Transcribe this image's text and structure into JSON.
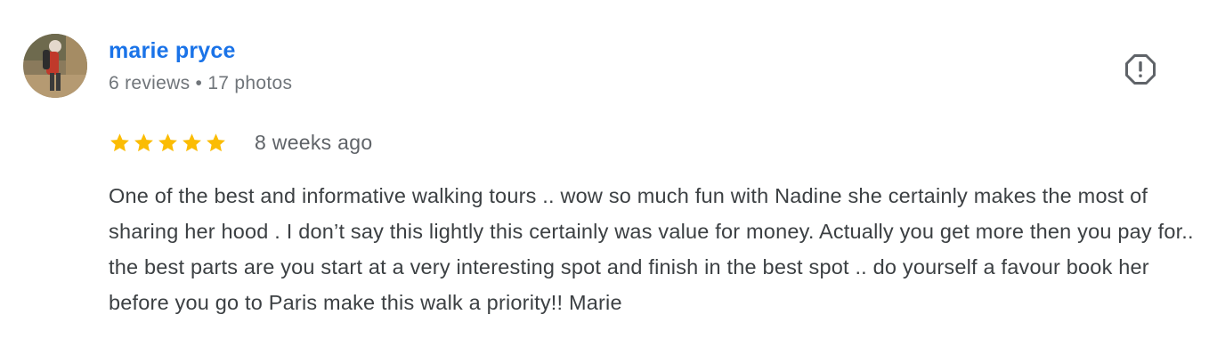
{
  "reviewer": {
    "name": "marie pryce",
    "meta": "6 reviews • 17 photos",
    "avatar_icon": "user-photo-avatar"
  },
  "review": {
    "rating": 5,
    "max_rating": 5,
    "date": "8 weeks ago",
    "text": "One of the best and informative walking tours .. wow so much fun with Nadine she certainly makes the most of sharing her hood . I don’t say this lightly this certainly was value for money. Actually you get more then you pay for.. the best parts are you start at a very interesting spot and finish in the best spot .. do yourself a favour book her before you go to Paris make this walk a priority!! Marie"
  },
  "actions": {
    "report_icon": "report-icon"
  },
  "colors": {
    "name": "#1a73e8",
    "star": "#fbbc04",
    "meta": "#70757a",
    "text": "#3c4043"
  }
}
